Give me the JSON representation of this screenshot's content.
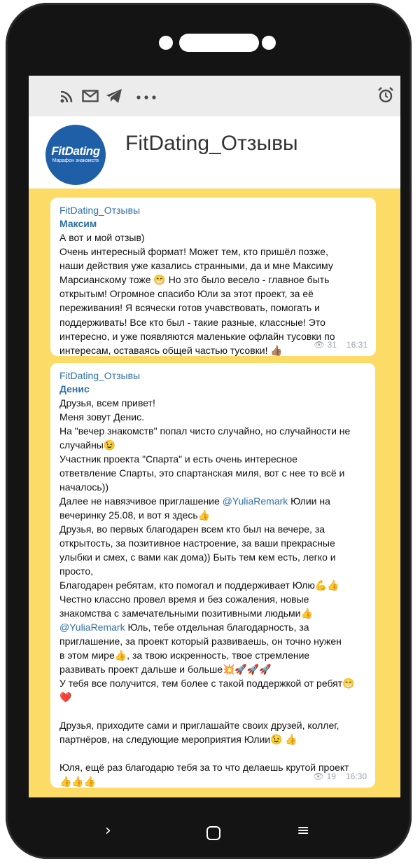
{
  "status_bar": {
    "icons": [
      "rss-icon",
      "mail-icon",
      "telegram-icon",
      "more-dots-icon",
      "alarm-icon"
    ],
    "glyphs": {
      "rss": "))",
      "mail": "✉",
      "telegram": "➤",
      "more": "•••",
      "alarm": "⏰"
    }
  },
  "channel": {
    "title": "FitDating_Отзывы",
    "avatar_logo": "FitDating",
    "avatar_subtitle": "Марафон знакомств"
  },
  "messages": [
    {
      "channel": "FitDating_Отзывы",
      "author": "Максим",
      "lines": [
        "А вот и мой отзыв)",
        "Очень интересный формат! Может тем, кто пришёл позже,",
        "наши действия уже казались странными, да и мне Максиму",
        "Марсианскому тоже 😁 Но это было весело - главное быть",
        "открытым! Огромное спасибо Юли за этот проект, за её",
        "переживания! Я всячески готов учавствовать, помогать и",
        "поддерживать! Все кто был - такие разные, классные! Это",
        "интересно, и уже появляются маленькие офлайн тусовки по",
        "интересам, оставаясь общей частью тусовки! 👍🏽"
      ],
      "views": "31",
      "time": "16:31"
    },
    {
      "channel": "FitDating_Отзывы",
      "author": "Денис",
      "lines": [
        "Друзья, всем привет!",
        "Меня зовут Денис.",
        "На \"вечер знакомств\" попал чисто случайно, но случайности не",
        "случайны😉",
        "Участник проекта \"Спарта\" и есть очень интересное",
        "ответвление Спарты, это спартанская миля, вот с нее то всё и",
        "началось))",
        "Далее не навязчивое приглашение  @YuliaRemark Юлии на",
        "вечеринку 25.08, и вот я здесь👍",
        "Друзья, во первых благодарен всем кто был на вечере, за",
        "открытость, за позитивное настроение, за ваши прекрасные",
        "улыбки и смех, с вами как дома)) Быть тем кем есть, легко и",
        "просто,",
        "Благодарен ребятам, кто помогал и поддерживает Юлю💪👍",
        "Честно классно провел время и без сожаления, новые",
        "знакомства с замечательными позитивными людьми👍",
        "@YuliaRemark Юль, тебе отдельная благодарность, за",
        "приглашение, за проект который развиваешь, он точно нужен",
        "в этом мире👍, за твою искренность, твое стремление",
        "развивать проект дальше и больше💥🚀🚀🚀",
        "У тебя все получится, тем более с такой поддержкой от ребят😁",
        "❤️",
        "",
        "Друзья, приходите сами и приглашайте своих друзей, коллег,",
        "партнёров, на следующие мероприятия Юлии😉 👍",
        "",
        "Юля, ещё раз благодарю тебя за то что делаешь крутой проект",
        "👍👍👍"
      ],
      "mention": "@YuliaRemark",
      "views": "19",
      "time": "16:30"
    }
  ],
  "nav": {
    "back": "›",
    "menu": "≡"
  },
  "colors": {
    "background": "#fcdc67",
    "accent": "#2e6fa6",
    "avatar": "#1f5fa8"
  }
}
